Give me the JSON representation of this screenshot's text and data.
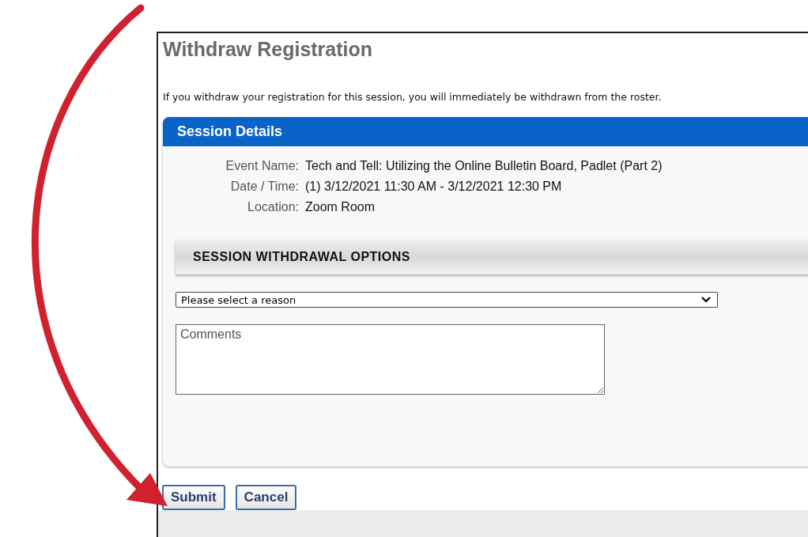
{
  "page": {
    "title": "Withdraw Registration",
    "intro": "If you withdraw your registration for this session, you will immediately be withdrawn from the roster."
  },
  "session_details": {
    "heading": "Session Details",
    "fields": [
      {
        "label": "Event Name:",
        "value": "Tech and Tell: Utilizing the Online Bulletin Board, Padlet (Part 2)"
      },
      {
        "label": "Date / Time:",
        "value": "(1) 3/12/2021 11:30 AM - 3/12/2021 12:30 PM"
      },
      {
        "label": "Location:",
        "value": "Zoom Room"
      }
    ]
  },
  "withdrawal_options": {
    "heading": "SESSION WITHDRAWAL OPTIONS",
    "reason_select": {
      "value": "Please select a reason"
    },
    "comments": {
      "placeholder": "Comments"
    }
  },
  "buttons": [
    "Submit",
    "Cancel"
  ]
}
